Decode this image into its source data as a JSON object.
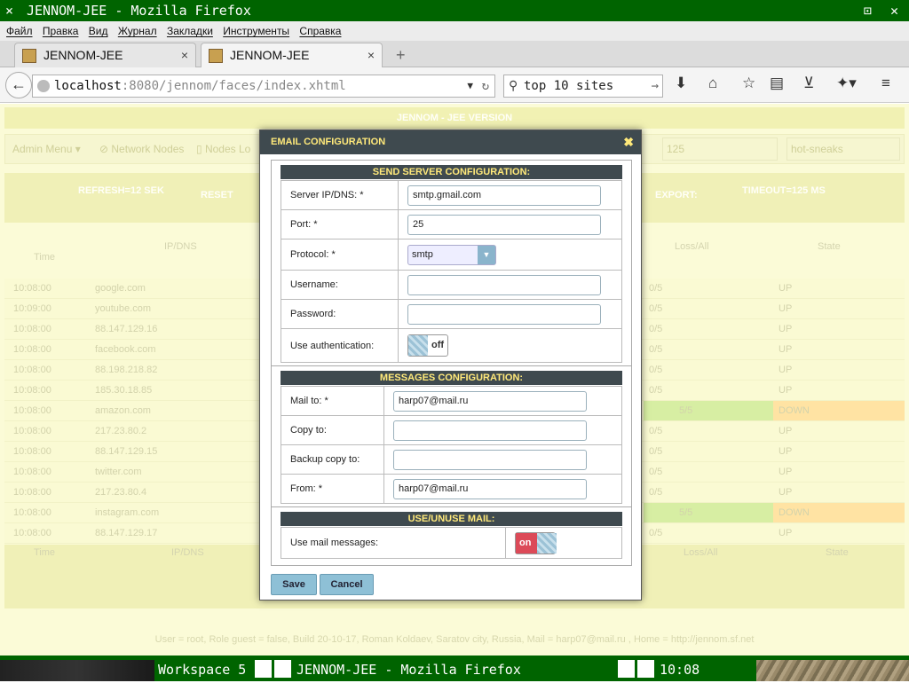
{
  "window": {
    "title": "JENNOM-JEE - Mozilla Firefox",
    "menu_glyph": "⨯",
    "controls": "⊡ ✕"
  },
  "menubar": {
    "items": [
      "Файл",
      "Правка",
      "Вид",
      "Журнал",
      "Закладки",
      "Инструменты",
      "Справка"
    ]
  },
  "tabs": [
    {
      "label": "JENNOM-JEE",
      "close": "×"
    },
    {
      "label": "JENNOM-JEE",
      "close": "×"
    }
  ],
  "newtab_glyph": "+",
  "navbar": {
    "url_host": "localhost",
    "url_rest": ":8080/jennom/faces/index.xhtml",
    "search_text": "top 10 sites"
  },
  "background": {
    "app_title": "JENNOM - JEE VERSION",
    "admin_menu": "Admin Menu ▾",
    "network_nodes": "Network Nodes",
    "nodes_log": "Nodes Lo",
    "refresh": "REFRESH=12 SEK",
    "reset": "RESET",
    "export": "EXPORT:",
    "timeout": "TIMEOUT=125 MS",
    "select_125": "125",
    "select_hot": "hot-sneaks",
    "col_time": "Time",
    "col_ip": "IP/DNS",
    "col_loss": "Loss/All",
    "col_state": "State",
    "rows": [
      {
        "time": "10:08:00",
        "ip": "google.com",
        "loss": "0/5",
        "state": "UP"
      },
      {
        "time": "10:09:00",
        "ip": "youtube.com",
        "loss": "0/5",
        "state": "UP"
      },
      {
        "time": "10:08:00",
        "ip": "88.147.129.16",
        "loss": "0/5",
        "state": "UP"
      },
      {
        "time": "10:08:00",
        "ip": "facebook.com",
        "loss": "0/5",
        "state": "UP"
      },
      {
        "time": "10:08:00",
        "ip": "88.198.218.82",
        "loss": "0/5",
        "state": "UP"
      },
      {
        "time": "10:08:00",
        "ip": "185.30.18.85",
        "loss": "0/5",
        "state": "UP"
      },
      {
        "time": "10:08:00",
        "ip": "amazon.com",
        "loss": "5/5",
        "state": "DOWN"
      },
      {
        "time": "10:08:00",
        "ip": "217.23.80.2",
        "loss": "0/5",
        "state": "UP"
      },
      {
        "time": "10:08:00",
        "ip": "88.147.129.15",
        "loss": "0/5",
        "state": "UP"
      },
      {
        "time": "10:08:00",
        "ip": "twitter.com",
        "loss": "0/5",
        "state": "UP"
      },
      {
        "time": "10:08:00",
        "ip": "217.23.80.4",
        "loss": "0/5",
        "state": "UP"
      },
      {
        "time": "10:08:00",
        "ip": "instagram.com",
        "loss": "5/5",
        "state": "DOWN"
      },
      {
        "time": "10:08:00",
        "ip": "88.147.129.17",
        "loss": "0/5",
        "state": "UP"
      }
    ],
    "footer": "User = root, Role guest = false, Build 20-10-17, Roman Koldaev, Saratov city, Russia, Mail = harp07@mail.ru , Home = http://jennom.sf.net"
  },
  "modal": {
    "title": "EMAIL CONFIGURATION",
    "close": "✖",
    "send_section": "SEND SERVER CONFIGURATION:",
    "server_label": "Server IP/DNS:  *",
    "server_value": "smtp.gmail.com",
    "port_label": "Port:  *",
    "port_value": "25",
    "protocol_label": "Protocol:  *",
    "protocol_value": "smtp",
    "username_label": "Username:",
    "username_value": "",
    "password_label": "Password:",
    "password_value": "",
    "auth_label": "Use authentication:",
    "auth_state": "off",
    "messages_section": "MESSAGES CONFIGURATION:",
    "mailto_label": "Mail to:  *",
    "mailto_value": "harp07@mail.ru",
    "copyto_label": "Copy to:",
    "copyto_value": "",
    "backup_label": "Backup copy to:",
    "backup_value": "",
    "from_label": "From:  *",
    "from_value": "harp07@mail.ru",
    "use_section": "USE/UNUSE MAIL:",
    "usemail_label": "Use mail messages:",
    "usemail_state": "on",
    "save": "Save",
    "cancel": "Cancel"
  },
  "taskbar": {
    "workspace": "Workspace 5",
    "window": "JENNOM-JEE - Mozilla Firefox",
    "clock": "10:08"
  }
}
